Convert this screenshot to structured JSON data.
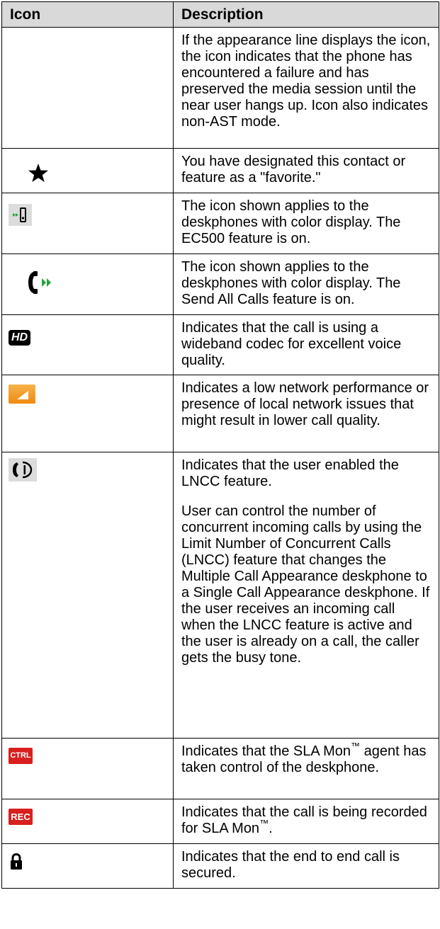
{
  "table": {
    "headers": {
      "icon": "Icon",
      "description": "Description"
    },
    "rows": [
      {
        "icon": "preserved-media-session-icon",
        "lines": [
          "If the appearance line displays the icon, the icon indicates that the phone has encountered a failure and has preserved the media session until the near user hangs up. Icon also indicates non-AST mode."
        ]
      },
      {
        "icon": "star-icon",
        "lines": [
          "You have designated this contact or feature as a \"favorite.\""
        ]
      },
      {
        "icon": "ec500-icon",
        "lines": [
          "The icon shown applies to the deskphones with color display. The EC500 feature is on."
        ]
      },
      {
        "icon": "send-all-calls-icon",
        "lines": [
          "The icon shown applies to the deskphones with color display. The Send All Calls feature is on."
        ]
      },
      {
        "icon": "hd-icon",
        "icon_text": "HD",
        "lines": [
          "Indicates that the call is using a wideband codec for excellent voice quality."
        ]
      },
      {
        "icon": "low-network-icon",
        "lines": [
          "Indicates a low network performance or presence of local network issues that might result in lower call quality."
        ]
      },
      {
        "icon": "lncc-icon",
        "lines": [
          "Indicates that the user enabled the LNCC feature.",
          "User can control the number of concurrent incoming calls by using the Limit Number of Concurrent Calls (LNCC) feature that changes the Multiple Call Appearance deskphone to a Single Call Appearance deskphone. If the user receives an incoming call when the LNCC feature is active and the user is already on a call, the caller gets the busy tone."
        ]
      },
      {
        "icon": "ctrl-icon",
        "icon_text": "CTRL",
        "lines": [
          "Indicates that the SLA Mon",
          "agent has taken control of the deskphone."
        ]
      },
      {
        "icon": "rec-icon",
        "icon_text": "REC",
        "lines": [
          "Indicates that the call is being recorded for SLA Mon",
          "."
        ]
      },
      {
        "icon": "lock-icon",
        "lines": [
          "Indicates that the end to end call is secured."
        ]
      }
    ],
    "tm": "™"
  },
  "colors": {
    "header_bg": "#d9d9d9",
    "icon_gray_bg": "#dcdcdc",
    "green_arrow": "#22a43a",
    "orange": "#f39a1c",
    "red_badge": "#d8201f"
  }
}
